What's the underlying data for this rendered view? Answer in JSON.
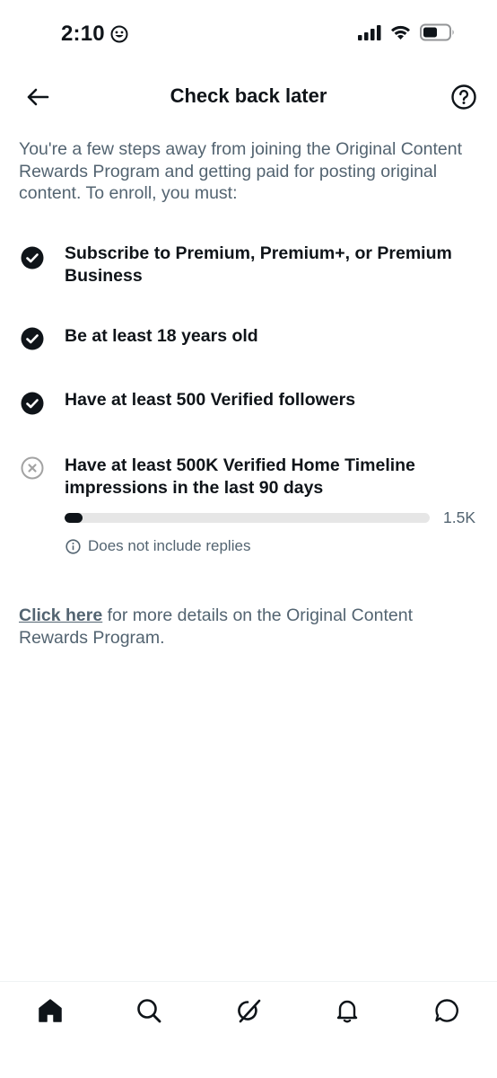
{
  "status_bar": {
    "time": "2:10"
  },
  "header": {
    "title": "Check back later"
  },
  "intro": "You're a few steps away from joining the Original Content Rewards Program and getting paid for posting original content. To enroll, you must:",
  "requirements": [
    {
      "text": "Subscribe to Premium, Premium+, or Premium Business",
      "status": "met"
    },
    {
      "text": "Be at least 18 years old",
      "status": "met"
    },
    {
      "text": "Have at least 500 Verified followers",
      "status": "met"
    },
    {
      "text": "Have at least 500K Verified Home Timeline impressions in the last 90 days",
      "status": "not-met"
    }
  ],
  "impressions": {
    "current_label": "1.5K",
    "progress_fraction": 0.05,
    "note": "Does not include replies"
  },
  "footer": {
    "link_text": "Click here",
    "rest_text": " for more details on the Original Content Rewards Program."
  },
  "colors": {
    "text_primary": "#0f1419",
    "text_secondary": "#536471",
    "track": "#e6e6e6",
    "fail_icon": "#a3a3a3"
  }
}
